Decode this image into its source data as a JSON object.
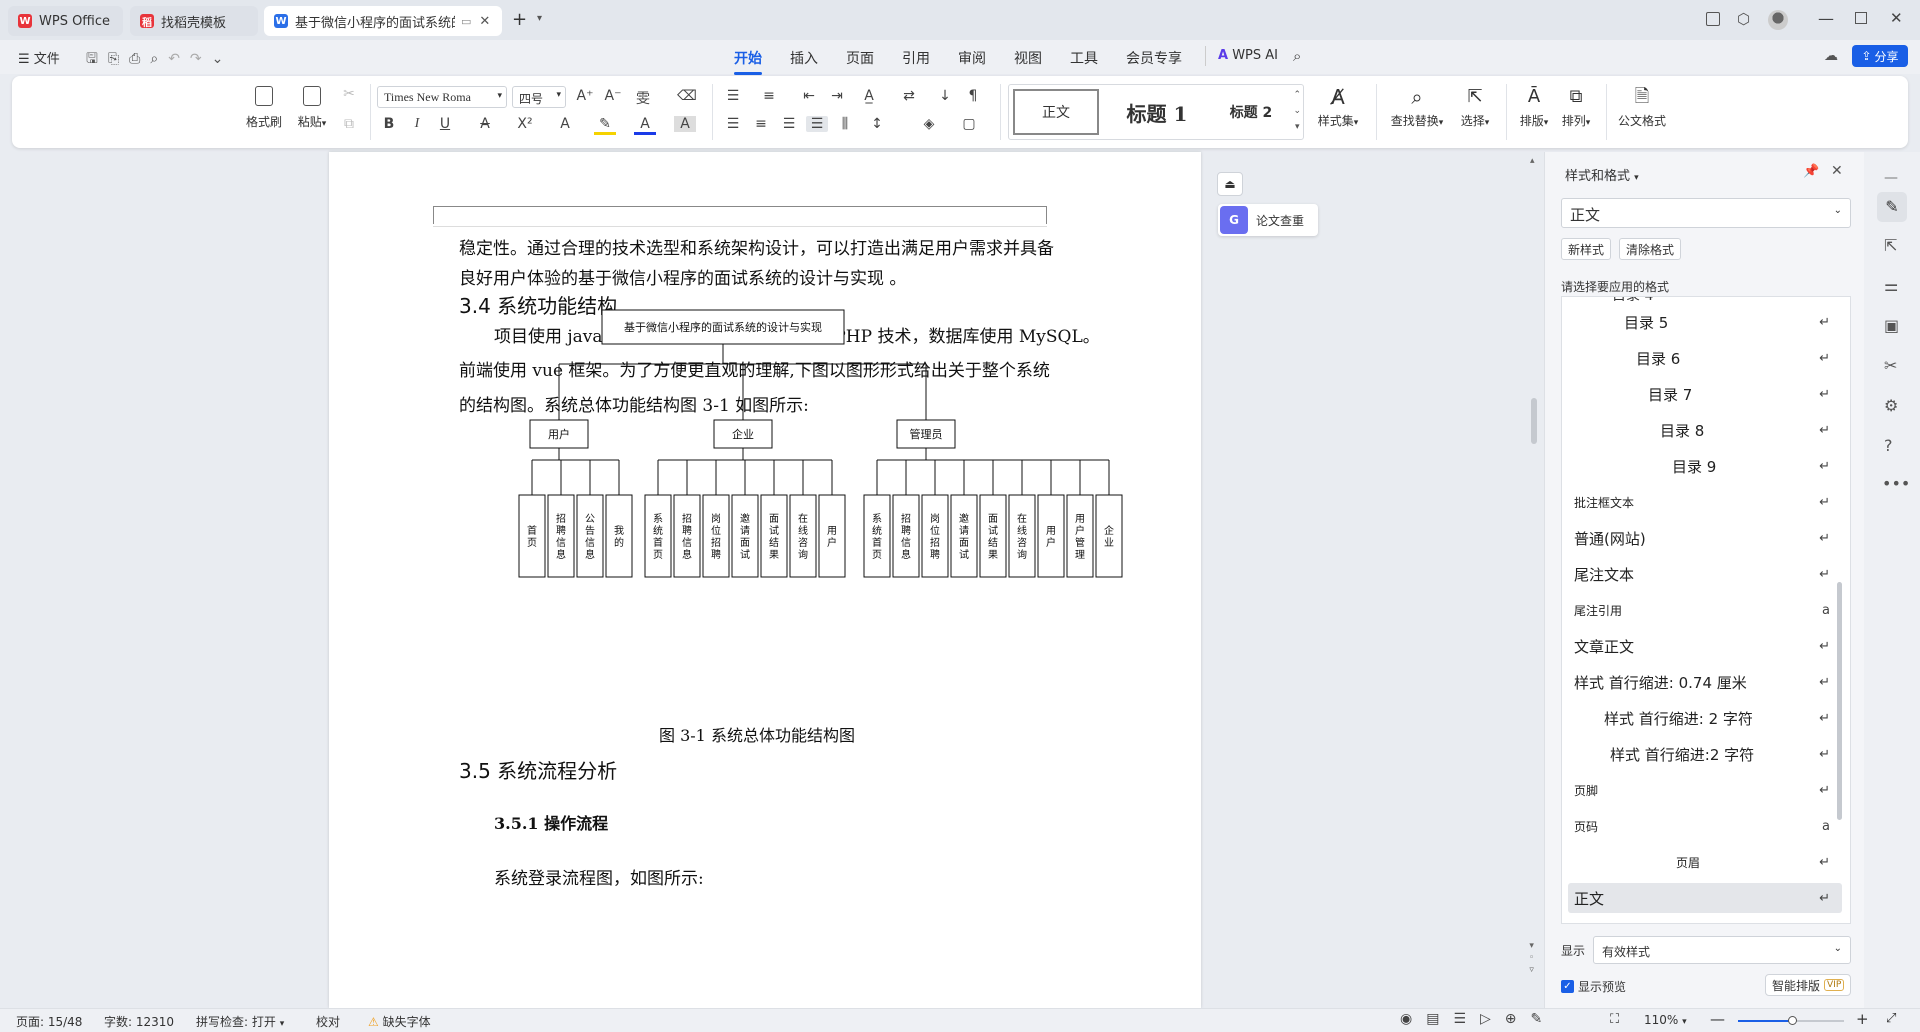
{
  "titlebar": {
    "tabs": [
      {
        "label": "WPS Office",
        "color": "#e8343b"
      },
      {
        "label": "找稻壳模板",
        "color": "#e8343b"
      },
      {
        "label": "基于微信小程序的面试系统的设计与实现",
        "color": "#2b6fe8"
      }
    ],
    "add_tab": "+"
  },
  "menubar": {
    "file_label": "文件",
    "tabs": [
      "开始",
      "插入",
      "页面",
      "引用",
      "审阅",
      "视图",
      "工具",
      "会员专享"
    ],
    "wps_ai": "WPS AI",
    "share": "分享"
  },
  "ribbon": {
    "format_painter": "格式刷",
    "paste": "粘贴",
    "font_name": "Times New Roma",
    "font_size": "四号",
    "styles": [
      "正文",
      "标题 1",
      "标题 2"
    ],
    "style_set": "样式集",
    "find_replace": "查找替换",
    "select": "选择",
    "layout": "排版",
    "arrange": "排列",
    "doc_format": "公文格式"
  },
  "document": {
    "para1_line1": "稳定性。通过合理的技术选型和系统架构设计，可以打造出满足用户需求并具备",
    "para1_line2": "良好用户体验的基于微信小程序的面试系统的设计与实现 。",
    "heading_34": "3.4 系统功能结构",
    "para2_line1": "项目使用 java 作为开发语言，后端框架使用 PHP 技术，数据库使用 MySQL。",
    "para2_line2": "前端使用 vue 框架。为了方便更直观的理解,下图以图形形式给出关于整个系统",
    "para2_line3": "的结构图。系统总体功能结构图 3-1 如图所示:",
    "diagram": {
      "root": "基于微信小程序的面试系统的设计与实现",
      "groups": [
        {
          "name": "用户",
          "children": [
            "首页",
            "招聘信息",
            "公告信息",
            "我的"
          ]
        },
        {
          "name": "企业",
          "children": [
            "系统首页",
            "招聘信息",
            "岗位招聘",
            "邀请面试",
            "面试结果",
            "在线咨询",
            "用户"
          ]
        },
        {
          "name": "管理员",
          "children": [
            "系统首页",
            "招聘信息",
            "岗位招聘",
            "邀请面试",
            "面试结果",
            "在线咨询",
            "用户",
            "用户管理",
            "企业"
          ]
        }
      ]
    },
    "caption": "图 3-1 系统总体功能结构图",
    "heading_35": "3.5 系统流程分析",
    "heading_351": "3.5.1 操作流程",
    "para3": "系统登录流程图，如图所示:"
  },
  "float": {
    "thesis_check": "论文查重"
  },
  "stylepanel": {
    "title": "样式和格式",
    "current_style": "正文",
    "new_style": "新样式",
    "clear_format": "清除格式",
    "apply_hint": "请选择要应用的格式",
    "items": [
      {
        "label": "目录 5",
        "indent": 50,
        "ret": "↵"
      },
      {
        "label": "目录 6",
        "indent": 62,
        "ret": "↵"
      },
      {
        "label": "目录 7",
        "indent": 74,
        "ret": "↵"
      },
      {
        "label": "目录 8",
        "indent": 86,
        "ret": "↵"
      },
      {
        "label": "目录 9",
        "indent": 98,
        "ret": "↵"
      },
      {
        "label": "批注框文本",
        "indent": 0,
        "ret": "↵",
        "small": true
      },
      {
        "label": "普通(网站)",
        "indent": 0,
        "ret": "↵"
      },
      {
        "label": "尾注文本",
        "indent": 0,
        "ret": "↵"
      },
      {
        "label": "尾注引用",
        "indent": 0,
        "ret": "a",
        "small": true
      },
      {
        "label": "文章正文",
        "indent": 0,
        "ret": "↵"
      },
      {
        "label": "样式 首行缩进: 0.74 厘米",
        "indent": 0,
        "ret": "↵"
      },
      {
        "label": "样式 首行缩进: 2 字符",
        "indent": 30,
        "ret": "↵"
      },
      {
        "label": "样式 首行缩进:2 字符",
        "indent": 36,
        "ret": "↵"
      },
      {
        "label": "页脚",
        "indent": 0,
        "ret": "↵",
        "small": true
      },
      {
        "label": "页码",
        "indent": 0,
        "ret": "a",
        "small": true
      },
      {
        "label": "页眉",
        "indent": 102,
        "ret": "↵",
        "small": true
      },
      {
        "label": "正文",
        "indent": 0,
        "ret": "↵",
        "selected": true
      }
    ],
    "show_label": "显示",
    "show_value": "有效样式",
    "show_preview": "显示预览",
    "smart_layout": "智能排版",
    "vip": "VIP"
  },
  "statusbar": {
    "page": "页面: 15/48",
    "words": "字数: 12310",
    "spell": "拼写检查: 打开",
    "proof": "校对",
    "missing_font": "缺失字体",
    "zoom": "110%"
  },
  "colors": {
    "accent": "#1a5fe6"
  }
}
